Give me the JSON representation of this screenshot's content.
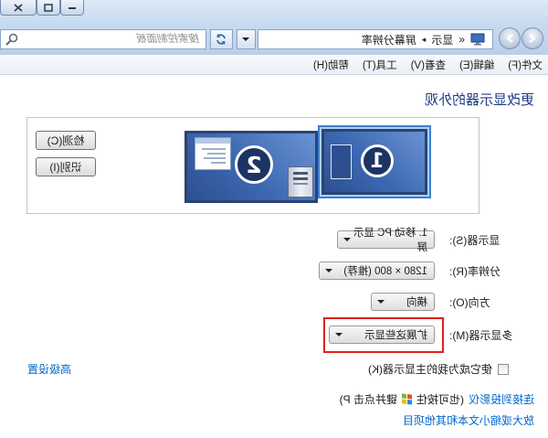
{
  "window": {
    "minimize_icon": "minimize-icon",
    "maximize_icon": "maximize-icon",
    "close_icon": "close-icon"
  },
  "address_bar": {
    "back_icon": "back-arrow-icon",
    "forward_icon": "forward-arrow-icon",
    "location_icon": "display-control-panel-icon",
    "prefix": "«",
    "crumbs": [
      "显示",
      "屏幕分辨率"
    ],
    "separator": "▸",
    "refresh_icon": "refresh-icon",
    "search_placeholder": "搜索控制面板",
    "search_icon": "search-icon"
  },
  "menu": [
    "文件(F)",
    "编辑(E)",
    "查看(V)",
    "工具(T)",
    "帮助(H)"
  ],
  "heading": "更改显示器的外观",
  "preview": {
    "detect_label": "检测(C)",
    "identify_label": "识别(I)",
    "monitors": [
      {
        "number": "1",
        "selected": true
      },
      {
        "number": "2",
        "selected": false
      }
    ]
  },
  "settings": [
    {
      "label": "显示器(S):",
      "value": "1. 移动 PC 显示屏"
    },
    {
      "label": "分辨率(R):",
      "value": "1280 × 800 (推荐)"
    },
    {
      "label": "方向(O):",
      "value": "横向"
    },
    {
      "label": "多显示器(M):",
      "value": "扩展这些显示"
    }
  ],
  "primary_checkbox": {
    "label": "使它成为我的主显示器(K)",
    "checked": false
  },
  "advanced_link": "高级设置",
  "links": {
    "projector": {
      "link": "连接到投影仪",
      "hint_prefix": "(也可按住",
      "key_icon": "windows-logo-icon",
      "hint_suffix": "键并点击 P)"
    },
    "text_size": "放大或缩小文本和其他项目"
  },
  "colors": {
    "link": "#0066cc",
    "heading": "#1e3a87",
    "highlight": "#e0201c",
    "monitor_screen": "#3d68b1"
  }
}
